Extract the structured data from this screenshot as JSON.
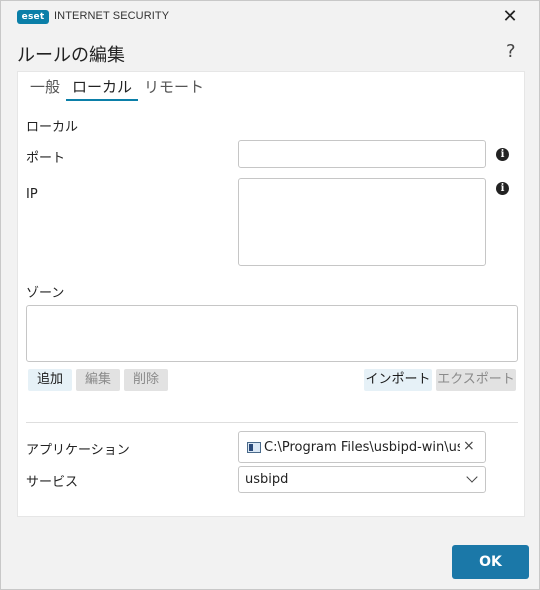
{
  "titlebar": {
    "logo": "eset",
    "product": "INTERNET SECURITY",
    "close_icon": "✕"
  },
  "dialog": {
    "title": "ルールの編集",
    "help": "?"
  },
  "tabs": [
    {
      "label": "一般",
      "active": false
    },
    {
      "label": "ローカル",
      "active": true
    },
    {
      "label": "リモート",
      "active": false
    }
  ],
  "local": {
    "section_title": "ローカル",
    "port_label": "ポート",
    "port_value": "",
    "ip_label": "IP",
    "ip_value": "",
    "info_icon": "i",
    "zone_label": "ゾーン",
    "zone_value": "",
    "buttons": {
      "add": "追加",
      "edit": "編集",
      "delete": "削除",
      "import": "インポート",
      "export": "エクスポート"
    }
  },
  "application": {
    "label": "アプリケーション",
    "path": "C:\\Program Files\\usbipd-win\\usb",
    "clear": "×"
  },
  "service": {
    "label": "サービス",
    "value": "usbipd"
  },
  "footer": {
    "ok": "OK"
  },
  "colors": {
    "accent": "#1b78a8",
    "tab_underline": "#0b7fa8",
    "logo_bg": "#0b7fa8"
  }
}
